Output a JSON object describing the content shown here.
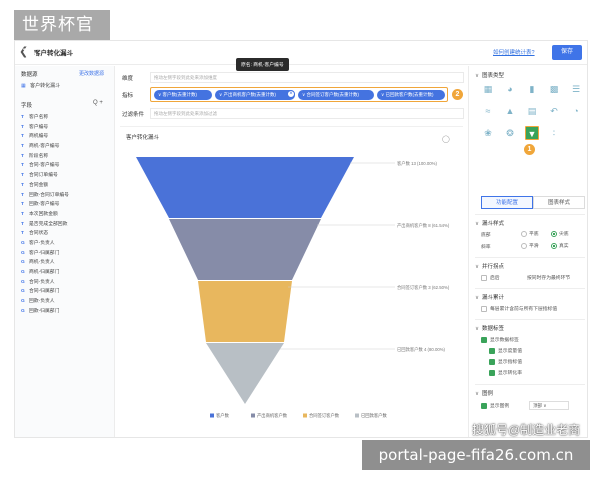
{
  "watermark": {
    "top": "世界杯官方",
    "bottom": "portal-page-fifa26.com.cn",
    "sohu": "搜狐号@制造业老商"
  },
  "topbar": {
    "title": "客户转化漏斗",
    "help_link": "如何创建统计表?",
    "save": "保存"
  },
  "left": {
    "datasource_header": "数据源",
    "datasource_change": "更改数据源",
    "datasource_name": "客户转化漏斗",
    "fields_header": "字段",
    "fields_tools": "Q  +",
    "fields": [
      {
        "t": "T",
        "label": "客户名称"
      },
      {
        "t": "T",
        "label": "客户编号"
      },
      {
        "t": "T",
        "label": "商机编号"
      },
      {
        "t": "T",
        "label": "商机-客户编号"
      },
      {
        "t": "T",
        "label": "阶段名称"
      },
      {
        "t": "T",
        "label": "合同-客户编号"
      },
      {
        "t": "T",
        "label": "合同订单编号"
      },
      {
        "t": "T",
        "label": "合同金额"
      },
      {
        "t": "T",
        "label": "回款-合同订单编号"
      },
      {
        "t": "T",
        "label": "回款-客户编号"
      },
      {
        "t": "T",
        "label": "本次回款金额"
      },
      {
        "t": "T",
        "label": "是否完成全部回款"
      },
      {
        "t": "T",
        "label": "合同状态"
      },
      {
        "t": "G",
        "label": "客户-负责人"
      },
      {
        "t": "G",
        "label": "客户-归属部门"
      },
      {
        "t": "G",
        "label": "商机-负责人"
      },
      {
        "t": "G",
        "label": "商机-归属部门"
      },
      {
        "t": "G",
        "label": "合同-负责人"
      },
      {
        "t": "G",
        "label": "合同-归属部门"
      },
      {
        "t": "G",
        "label": "回款-负责人"
      },
      {
        "t": "G",
        "label": "回款-归属部门"
      }
    ]
  },
  "config": {
    "dimension_label": "维度",
    "dimension_placeholder": "拖动左侧字段到此处来添加维度",
    "measure_label": "指标",
    "measures": [
      "客户数(去重计数)",
      "产出商机客户数(去重计数)",
      "合同签订客户数(去重计数)",
      "已回款客户数(去重计数)"
    ],
    "tooltip": "原名: 商机-客户编号",
    "badge_1": "1",
    "badge_2": "2",
    "filter_label": "过滤条件",
    "filter_placeholder": "拖动左侧字段到此处来添加过滤"
  },
  "chart_data": {
    "type": "funnel",
    "title": "客户转化漏斗",
    "stages": [
      {
        "name": "客户数",
        "value": 13,
        "percent": "100.00%",
        "color": "#4a72d8"
      },
      {
        "name": "产出商机客户数",
        "value": 8,
        "percent": "61.54%",
        "color": "#868ca8"
      },
      {
        "name": "合同签订客户数",
        "value": 3,
        "percent": "62.50%",
        "color": "#e8b75e"
      },
      {
        "name": "已回款客户数",
        "value": 4,
        "percent": "80.00%",
        "color": "#b8bfc5"
      }
    ],
    "labels": [
      "客户数 13 (100.00%)",
      "产出商机客户数 8 (61.54%)",
      "合同签订客户数 3 (62.50%)",
      "已回款客户数 4 (80.00%)"
    ],
    "legend": [
      "客户数",
      "产出商机客户数",
      "合同签订客户数",
      "已回款客户数"
    ]
  },
  "right": {
    "chart_type_title": "图表类型",
    "tab_config": "功能配置",
    "tab_style": "图表样式",
    "funnel_style_title": "漏斗样式",
    "shape_label": "底部",
    "shape_opt1": "平底",
    "shape_opt2": "尖底",
    "slope_label": "斜率",
    "slope_opt1": "平滑",
    "slope_opt2": "真实",
    "parallel_title": "并行拐点",
    "parallel_opt": "启后",
    "parallel_hint": "按同时存为最终环节",
    "accum_title": "漏斗累计",
    "accum_opt": "每层累计含前与所有下层指标值",
    "data_label_title": "数据标签",
    "show_data_label": "显示数据标签",
    "show_measure": "显示度量值",
    "show_metric": "显示指标值",
    "show_rate": "显示转化率",
    "legend_title": "图例",
    "show_legend": "显示图例",
    "legend_pos": "顶部"
  }
}
